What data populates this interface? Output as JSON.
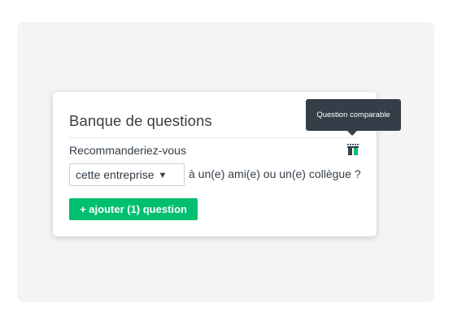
{
  "card": {
    "title": "Banque de questions",
    "question_start": "Recommanderiez-vous",
    "dropdown_value": "cette entreprise",
    "question_end": "à un(e) ami(e) ou un(e) collègue ?",
    "add_button_label": "+ ajouter (1) question",
    "benchmark_icon": "benchmark-chart-icon"
  },
  "tooltip": {
    "text": "Question comparable"
  },
  "colors": {
    "accent": "#00bf6f",
    "tooltip_bg": "#333e48",
    "text": "#333e48",
    "backdrop": "#f4f4f4"
  }
}
